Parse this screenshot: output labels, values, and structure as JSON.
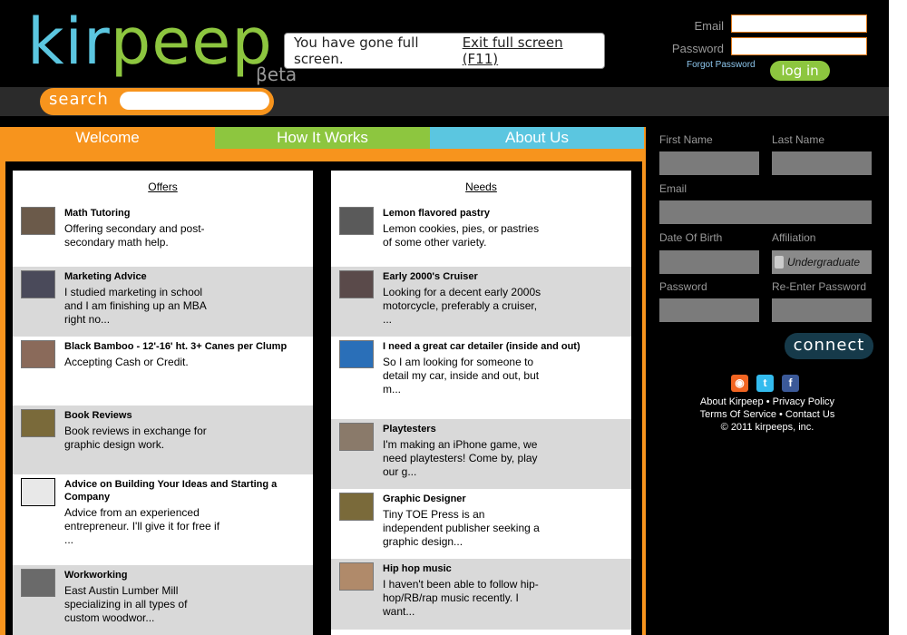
{
  "brand": {
    "logo_left": "kir",
    "logo_mid": "peep",
    "beta": "βeta"
  },
  "fullscreen_notice": {
    "message": "You have gone full screen.",
    "exit_label": "Exit full screen (F11)"
  },
  "login": {
    "email_label": "Email",
    "password_label": "Password",
    "forgot_label": "Forgot Password",
    "button_label": "log in"
  },
  "search": {
    "label": "search"
  },
  "tabs": [
    {
      "label": "Welcome"
    },
    {
      "label": "How It Works"
    },
    {
      "label": "About Us"
    }
  ],
  "offers": {
    "title": "Offers",
    "items": [
      {
        "title": "Math Tutoring",
        "desc": "Offering secondary and post-secondary math help."
      },
      {
        "title": "Marketing Advice",
        "desc": "I studied marketing in school and I am finishing up an MBA right no..."
      },
      {
        "title": "Black Bamboo - 12'-16' ht. 3+ Canes per Clump",
        "desc": "Accepting Cash or Credit."
      },
      {
        "title": "Book Reviews",
        "desc": "Book reviews in exchange for graphic design work."
      },
      {
        "title": "Advice on Building Your Ideas and Starting a Company",
        "desc": "Advice from an experienced entrepreneur. I'll give it for free if ..."
      },
      {
        "title": "Workworking",
        "desc": "East Austin Lumber Mill specializing in all types of custom woodwor..."
      }
    ]
  },
  "needs": {
    "title": "Needs",
    "items": [
      {
        "title": "Lemon flavored pastry",
        "desc": "Lemon cookies, pies, or pastries of some other variety."
      },
      {
        "title": "Early 2000's Cruiser",
        "desc": "Looking for a decent early 2000s motorcycle, preferably a cruiser, ..."
      },
      {
        "title": "I need a great car detailer (inside and out)",
        "desc": "So I am looking for someone to detail my car, inside and out, but m..."
      },
      {
        "title": "Playtesters",
        "desc": "I'm making an iPhone game, we need playtesters! Come by, play our g..."
      },
      {
        "title": "Graphic Designer",
        "desc": "Tiny TOE Press is an independent publisher seeking a graphic design..."
      },
      {
        "title": "Hip hop music",
        "desc": "I haven't been able to follow hip-hop/RB/rap music recently. I want..."
      }
    ]
  },
  "signup": {
    "first_name": "First Name",
    "last_name": "Last Name",
    "email": "Email",
    "dob": "Date Of Birth",
    "affiliation": "Affiliation",
    "affiliation_value": "Undergraduate",
    "password": "Password",
    "reenter": "Re-Enter Password",
    "connect_label": "connect"
  },
  "social": [
    {
      "icon": "rss-icon",
      "glyph": "◉",
      "color": "#f26522"
    },
    {
      "icon": "twitter-icon",
      "glyph": "t",
      "color": "#33bbee"
    },
    {
      "icon": "facebook-icon",
      "glyph": "f",
      "color": "#3b5998"
    }
  ],
  "footer": {
    "line1": "About Kirpeep • Privacy Policy",
    "line2": "Terms Of Service • Contact Us",
    "line3": "© 2011 kirpeeps, inc."
  },
  "colors": {
    "orange": "#f7941d",
    "green": "#8dc63f",
    "blue": "#5bc6e0"
  }
}
